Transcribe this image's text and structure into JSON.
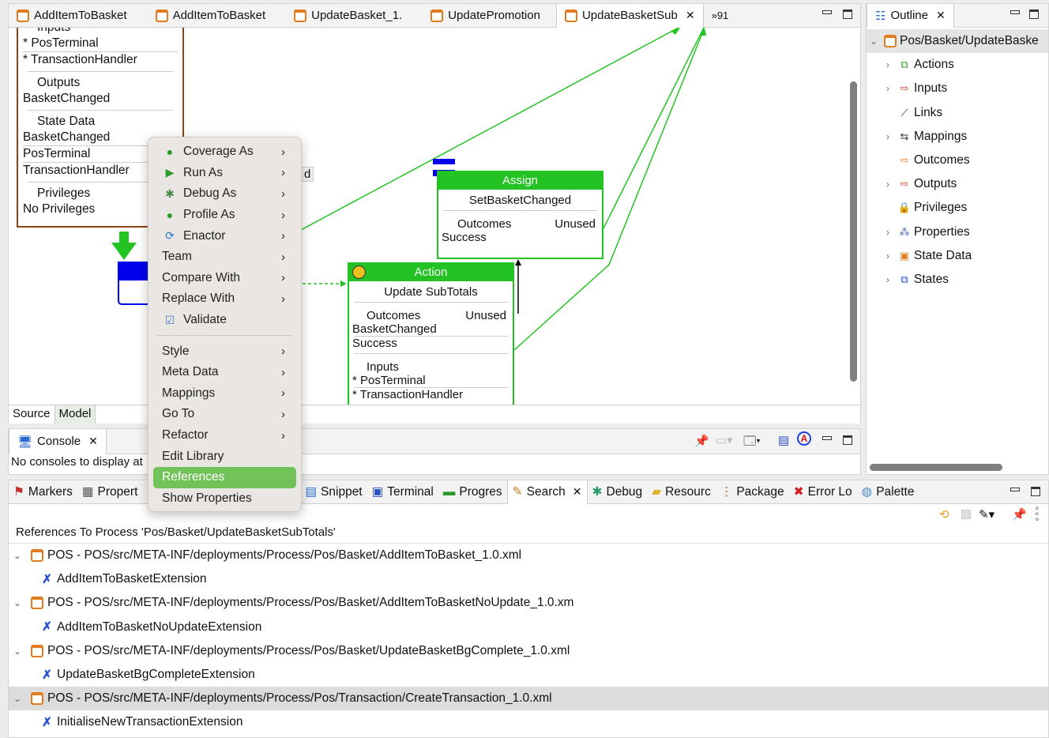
{
  "editor": {
    "tabs": [
      {
        "label": "AddItemToBasket"
      },
      {
        "label": "AddItemToBasket"
      },
      {
        "label": "UpdateBasket_1."
      },
      {
        "label": "UpdatePromotion"
      },
      {
        "label": "UpdateBasketSub",
        "active": true
      }
    ],
    "overflow_label": "»91",
    "bottom_tabs": [
      "Source",
      "Model"
    ],
    "diagram": {
      "left_box": {
        "inputs_title": "Inputs",
        "inputs": [
          "* PosTerminal",
          "* TransactionHandler"
        ],
        "outputs_title": "Outputs",
        "outputs": [
          "BasketChanged"
        ],
        "state_title": "State Data",
        "state": [
          "BasketChanged",
          "PosTerminal",
          "TransactionHandler"
        ],
        "priv_title": "Privileges",
        "priv": [
          "No Privileges"
        ]
      },
      "hidden_label_fragment": "d",
      "assign": {
        "header": "Assign",
        "name": "SetBasketChanged",
        "outcomes_title": "Outcomes",
        "outcomes_status": "Unused",
        "outcomes": [
          "Success"
        ]
      },
      "action": {
        "header": "Action",
        "name": "Update SubTotals",
        "outcomes_title": "Outcomes",
        "outcomes_status": "Unused",
        "outcomes": [
          "BasketChanged",
          "Success"
        ],
        "inputs_title": "Inputs",
        "inputs": [
          "* PosTerminal",
          "* TransactionHandler"
        ]
      },
      "colors": {
        "node": "#22c322",
        "start": "#0000ee",
        "line": "#22c322",
        "left_border": "#8b4513"
      }
    }
  },
  "context_menu": {
    "items": [
      {
        "label": "Coverage As",
        "icon": "coverage-icon",
        "submenu": true
      },
      {
        "label": "Run As",
        "icon": "run-icon",
        "submenu": true
      },
      {
        "label": "Debug As",
        "icon": "bug-icon",
        "submenu": true
      },
      {
        "label": "Profile As",
        "icon": "profile-icon",
        "submenu": true
      },
      {
        "label": "Enactor",
        "icon": "refresh-icon",
        "submenu": true
      },
      {
        "label": "Team",
        "submenu": true
      },
      {
        "label": "Compare With",
        "submenu": true
      },
      {
        "label": "Replace With",
        "submenu": true
      },
      {
        "label": "Validate",
        "icon": "checkbox-icon",
        "checked": true
      },
      {
        "label": "Style",
        "submenu": true
      },
      {
        "label": "Meta Data",
        "submenu": true
      },
      {
        "label": "Mappings",
        "submenu": true
      },
      {
        "label": "Go To",
        "submenu": true
      },
      {
        "label": "Refactor",
        "submenu": true
      },
      {
        "label": "Edit Library"
      },
      {
        "label": "References",
        "selected": true
      },
      {
        "label": "Show Properties"
      }
    ],
    "highlight_color": "#72c25a"
  },
  "outline": {
    "title": "Outline",
    "root": "Pos/Basket/UpdateBaske",
    "items": [
      {
        "label": "Actions",
        "expandable": true
      },
      {
        "label": "Inputs",
        "expandable": true
      },
      {
        "label": "Links",
        "expandable": false
      },
      {
        "label": "Mappings",
        "expandable": true
      },
      {
        "label": "Outcomes",
        "expandable": false
      },
      {
        "label": "Outputs",
        "expandable": true
      },
      {
        "label": "Privileges",
        "expandable": false
      },
      {
        "label": "Properties",
        "expandable": true
      },
      {
        "label": "State Data",
        "expandable": true
      },
      {
        "label": "States",
        "expandable": true
      }
    ]
  },
  "console": {
    "title": "Console",
    "message": "No consoles to display at"
  },
  "bottom": {
    "tabs": [
      "Markers",
      "Propert",
      "Snippet",
      "Terminal",
      "Progres",
      "Search",
      "Debug",
      "Resourc",
      "Package",
      "Error Lo",
      "Palette"
    ],
    "active_tab": "Search",
    "search_title": "References To Process 'Pos/Basket/UpdateBasketSubTotals'",
    "results": [
      {
        "file": "POS - POS/src/META-INF/deployments/Process/Pos/Basket/AddItemToBasket_1.0.xml",
        "child": "AddItemToBasketExtension"
      },
      {
        "file": "POS - POS/src/META-INF/deployments/Process/Pos/Basket/AddItemToBasketNoUpdate_1.0.xm",
        "child": "AddItemToBasketNoUpdateExtension"
      },
      {
        "file": "POS - POS/src/META-INF/deployments/Process/Pos/Basket/UpdateBasketBgComplete_1.0.xml",
        "child": "UpdateBasketBgCompleteExtension"
      },
      {
        "file": "POS - POS/src/META-INF/deployments/Process/Pos/Transaction/CreateTransaction_1.0.xml",
        "child": "InitialiseNewTransactionExtension",
        "selected": true
      }
    ]
  }
}
